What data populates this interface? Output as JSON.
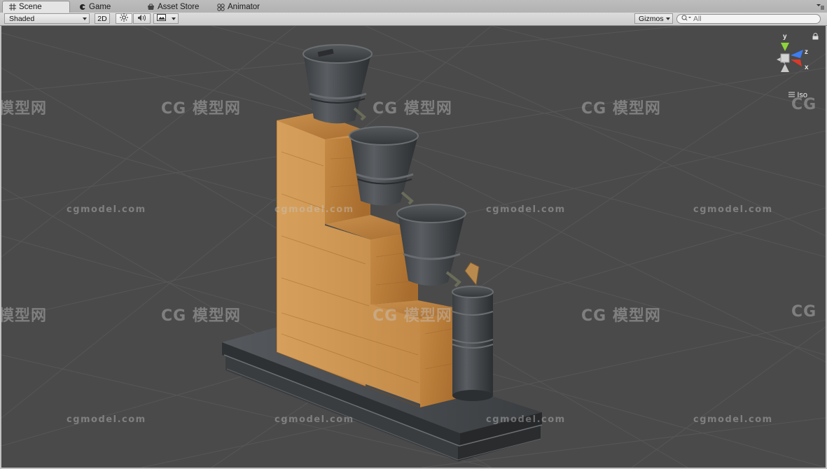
{
  "tabs": [
    {
      "label": "Scene",
      "icon": "grid-icon",
      "active": true
    },
    {
      "label": "Game",
      "icon": "game-icon",
      "active": false
    },
    {
      "label": "Asset Store",
      "icon": "store-icon",
      "active": false
    },
    {
      "label": "Animator",
      "icon": "animator-icon",
      "active": false
    }
  ],
  "toolbar": {
    "shading_mode": "Shaded",
    "toggle_2d": "2D",
    "lighting_icon": "sun-icon",
    "audio_icon": "speaker-icon",
    "effects_icon": "image-icon",
    "gizmos_label": "Gizmos",
    "search_placeholder": "All"
  },
  "viewport": {
    "projection_label": "Iso",
    "axis_labels": {
      "y": "y",
      "z": "z",
      "x": "x"
    },
    "axis_colors": {
      "y": "#8cd43a",
      "z": "#3d7df2",
      "x": "#d83a2a"
    },
    "background_color": "#4a4a4a"
  },
  "watermarks": {
    "logo_text": "模型网",
    "logo_prefix": "CG",
    "site_text": "cgmodel.com"
  }
}
